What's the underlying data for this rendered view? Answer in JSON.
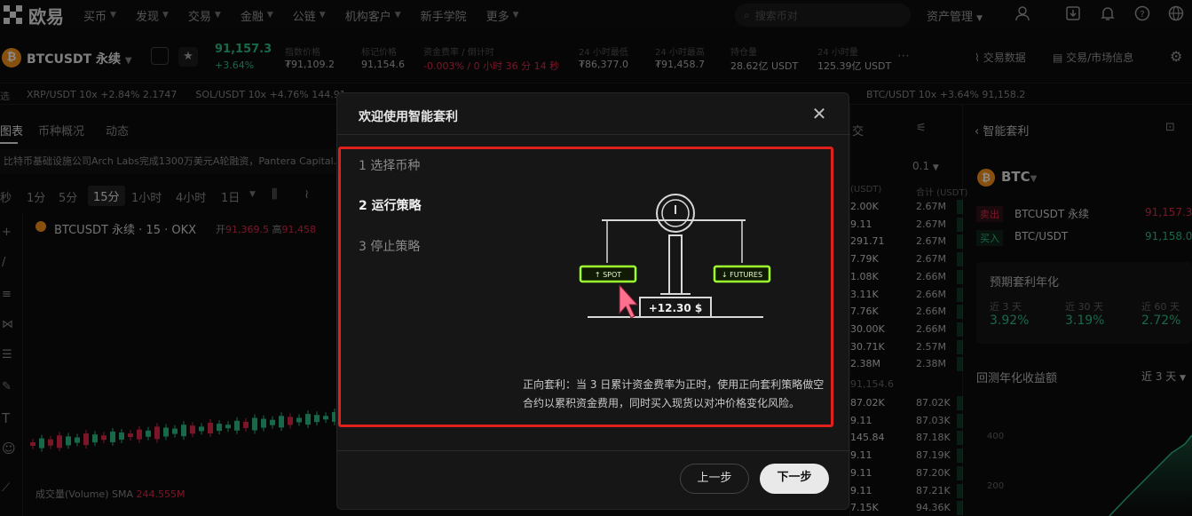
{
  "nav": {
    "brand": "欧易",
    "items": [
      "买币",
      "发现",
      "交易",
      "金融",
      "公链",
      "机构客户",
      "新手学院",
      "更多"
    ],
    "search_placeholder": "搜索币对",
    "asset": "资产管理"
  },
  "ticker": {
    "symbol": "BTCUSDT 永续",
    "coin_glyph": "₿",
    "price": "91,157.3",
    "change": "+3.64%",
    "stats": [
      {
        "label": "指数价格",
        "value": "₮91,109.2"
      },
      {
        "label": "标记价格",
        "value": "91,154.6"
      },
      {
        "label": "资金费率 / 倒计时",
        "value": "-0.003% / 0 小时 36 分 14 秒"
      },
      {
        "label": "24 小时最低",
        "value": "₮86,377.0"
      },
      {
        "label": "24 小时最高",
        "value": "₮91,458.7"
      },
      {
        "label": "持仓量",
        "value": "28.62亿 USDT"
      },
      {
        "label": "24 小时量",
        "value": "125.39亿 USDT"
      }
    ],
    "trade_data": "交易数据",
    "market_info": "交易/市场信息"
  },
  "marquee": {
    "left": "XRP/USDT 10x +2.84% 2.1747      SOL/USDT 10x +4.76% 144.91",
    "right": "BTC/USDT 10x +3.64% 91,158.2"
  },
  "left_panel": {
    "tabs": [
      "图表",
      "币种概况",
      "动态"
    ],
    "news": "比特币基础设施公司Arch Labs完成1300万美元A轮融资，Pantera Capital...",
    "timeframes": [
      "秒",
      "1分",
      "5分",
      "15分",
      "1小时",
      "4小时",
      "1日"
    ],
    "chart_title": "BTCUSDT 永续 · 15 · OKX",
    "open_label": "开",
    "open_value": "91,369.5",
    "high_label": "高",
    "high_value": "91,458",
    "volume_label": "成交量(Volume) SMA",
    "volume_value": "244.555M"
  },
  "orderbook": {
    "header_tab": "交",
    "depth": "0.1",
    "col1": "(USDT)",
    "col2": "合计 (USDT)",
    "rows": [
      [
        "2.00K",
        "2.67M"
      ],
      [
        "9.11",
        "2.67M"
      ],
      [
        "291.71",
        "2.67M"
      ],
      [
        "7.79K",
        "2.67M"
      ],
      [
        "1.08K",
        "2.66M"
      ],
      [
        "3.11K",
        "2.66M"
      ],
      [
        "7.76K",
        "2.66M"
      ],
      [
        "30.00K",
        "2.66M"
      ],
      [
        "30.71K",
        "2.57M"
      ],
      [
        "2.38M",
        "2.38M"
      ]
    ],
    "mid": "91,154.6",
    "rows2": [
      [
        "87.02K",
        "87.02K"
      ],
      [
        "9.11",
        "87.03K"
      ],
      [
        "145.84",
        "87.18K"
      ],
      [
        "9.11",
        "87.19K"
      ],
      [
        "9.11",
        "87.20K"
      ],
      [
        "9.11",
        "87.21K"
      ],
      [
        "7.15K",
        "94.36K"
      ]
    ]
  },
  "right_panel": {
    "title": "智能套利",
    "coin": "BTC",
    "rows": [
      {
        "tag": "卖出",
        "name": "BTCUSDT 永续",
        "price": "91,157.3"
      },
      {
        "tag": "买入",
        "name": "BTC/USDT",
        "price": "91,158.0"
      }
    ],
    "apy_title": "预期套利年化",
    "apy": [
      {
        "label": "近 3 天",
        "value": "3.92%"
      },
      {
        "label": "近 30 天",
        "value": "3.19%"
      },
      {
        "label": "近 60 天",
        "value": "2.72%"
      }
    ],
    "backtest": "回测年化收益额",
    "period": "近 3 天",
    "y400": "400",
    "y200": "200"
  },
  "modal": {
    "title": "欢迎使用智能套利",
    "steps": [
      "1 选择币种",
      "2 运行策略",
      "3 停止策略"
    ],
    "active_step": 1,
    "spot_label": "SPOT",
    "futures_label": "FUTURES",
    "profit": "+12.30 $",
    "description": "正向套利：当 3 日累计资金费率为正时，使用正向套利策略做空合约以累积资金费用，同时买入现货以对冲价格变化风险。",
    "prev": "上一步",
    "next": "下一步"
  },
  "colors": {
    "up": "#2ebd85",
    "down": "#e0294a",
    "neon": "#9cff2e",
    "highlight": "#e0201d",
    "cursor": "#ff6f8e"
  }
}
